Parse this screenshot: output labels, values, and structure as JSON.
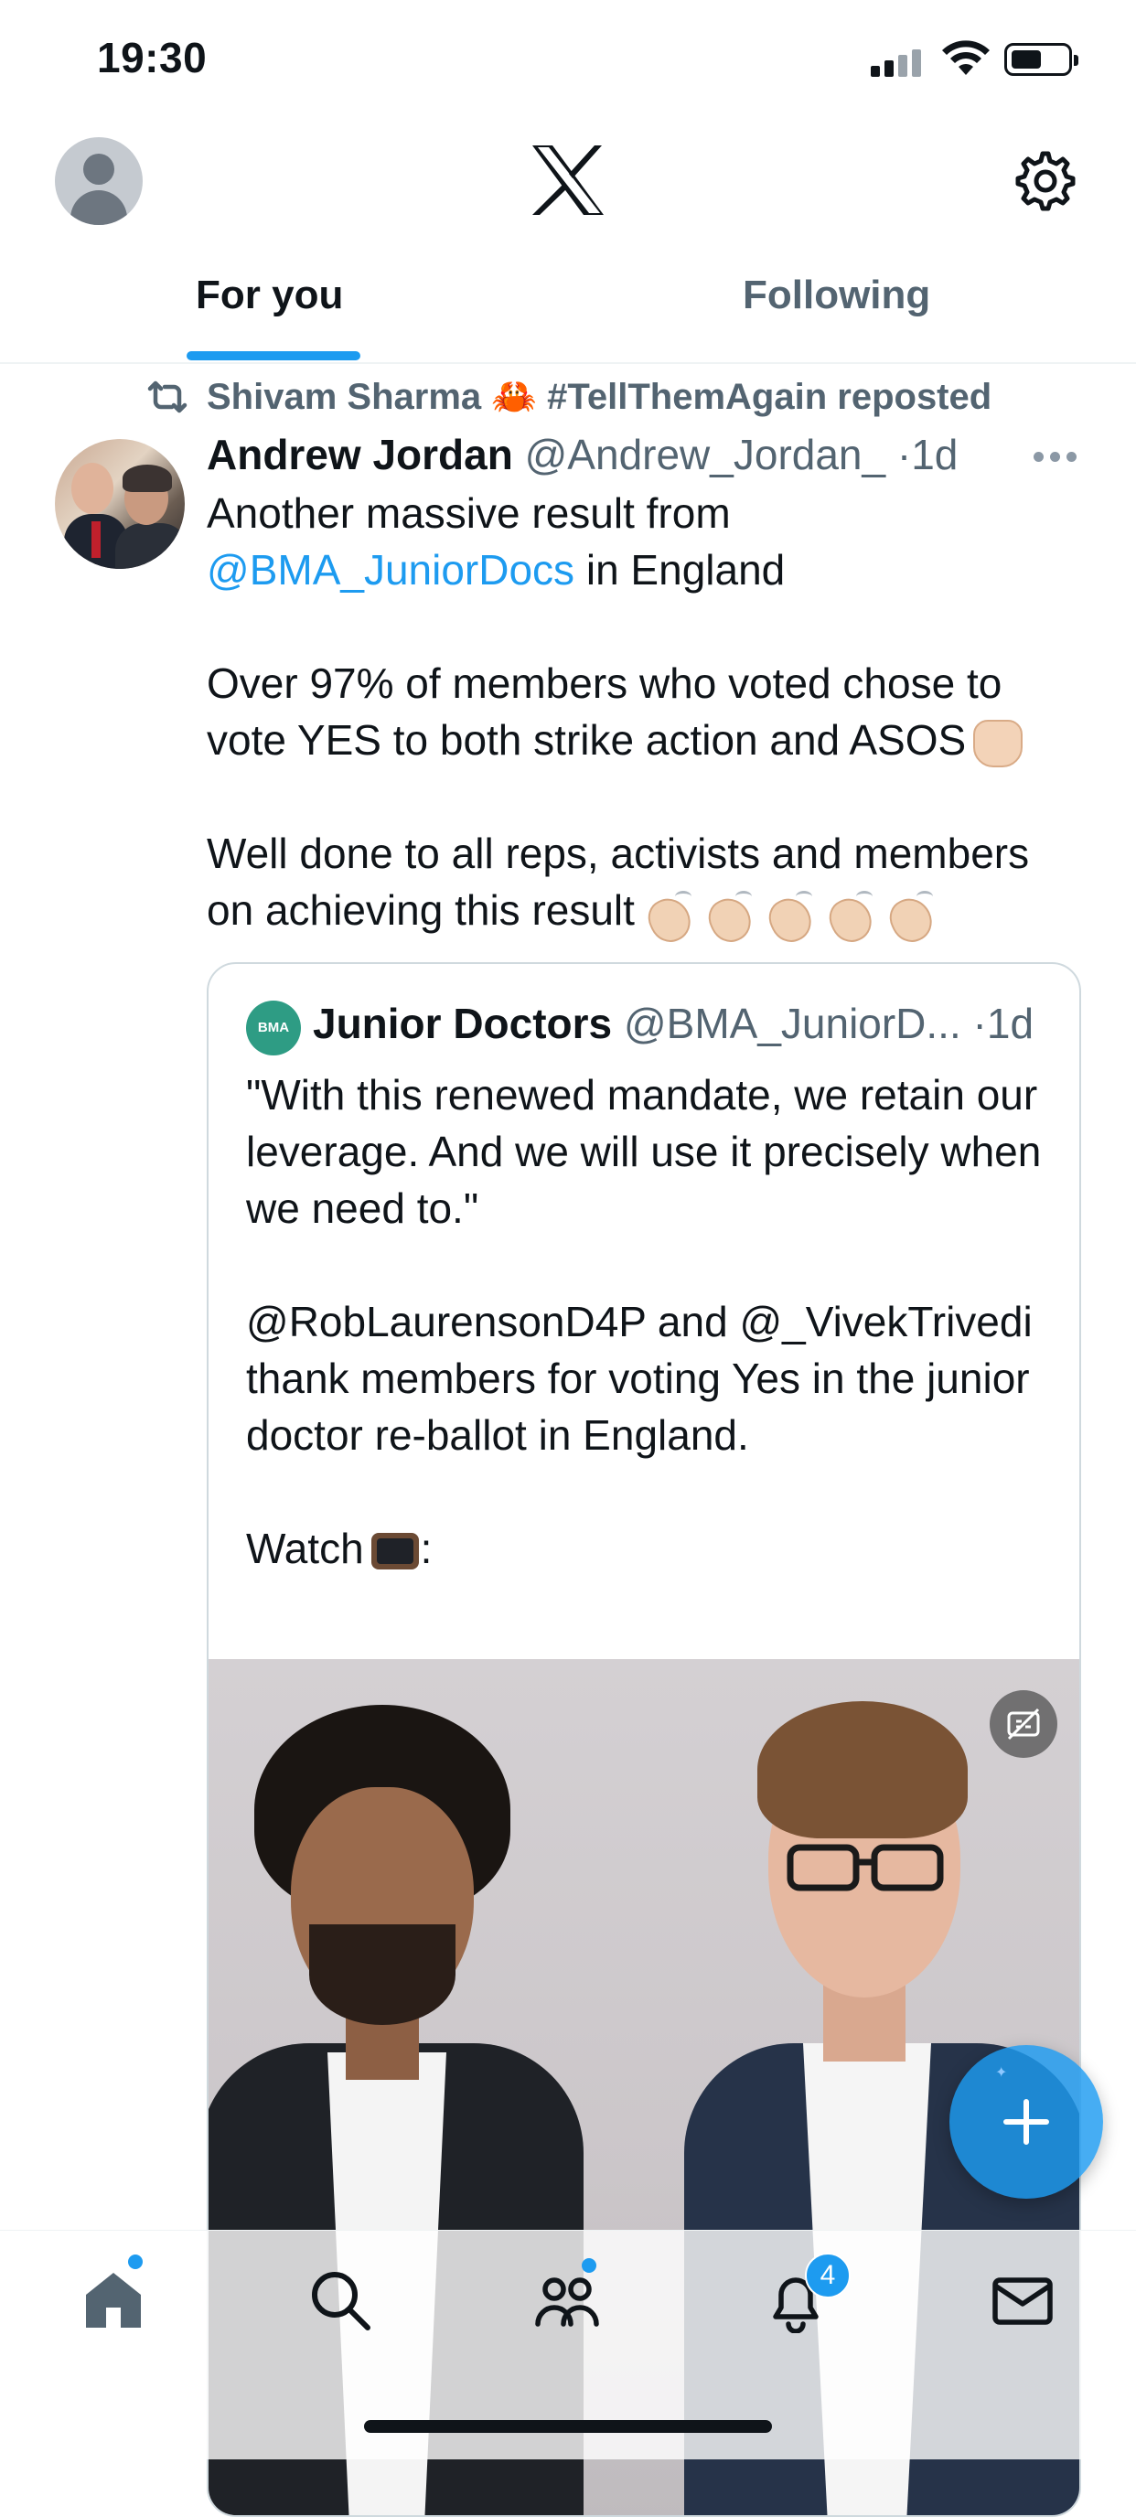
{
  "status_bar": {
    "time": "19:30",
    "battery_level": 0.55
  },
  "tabs": [
    {
      "label": "For you",
      "active": true
    },
    {
      "label": "Following",
      "active": false
    }
  ],
  "repost": {
    "text": "Shivam Sharma 🦀 #TellThemAgain reposted"
  },
  "tweet": {
    "author_name": "Andrew Jordan",
    "handle": "@Andrew_Jordan_",
    "separator": "·",
    "time": "1d",
    "line1": "Another massive result from",
    "mention": "@BMA_JuniorDocs",
    "line2_rest": " in England",
    "para2": "Over 97% of members who voted chose to vote YES to both strike action and ASOS",
    "para3": "Well done to all reps, activists and members on achieving this result"
  },
  "quote": {
    "logo_text": "BMA",
    "name": "Junior Doctors",
    "handle": "@BMA_JuniorD...",
    "separator": "·",
    "time": "1d",
    "para1": "\"With this renewed mandate, we retain our leverage. And we will use it precisely when we need to.\"",
    "para2": "@RobLaurensonD4P and @_VivekTrivedi thank members for voting Yes in the junior doctor re-ballot in England.",
    "para3": "Watch",
    "para3_suffix": ":"
  },
  "nav": {
    "notification_count": "4"
  },
  "icons": {
    "header": [
      "profile-avatar-icon",
      "x-logo-icon",
      "gear-icon"
    ],
    "nav": [
      "home-icon",
      "search-icon",
      "communities-icon",
      "bell-icon",
      "mail-icon"
    ],
    "fab": "plus-icon"
  },
  "colors": {
    "accent": "#1d9bf0",
    "text_primary": "#0f1419",
    "text_secondary": "#536471"
  }
}
